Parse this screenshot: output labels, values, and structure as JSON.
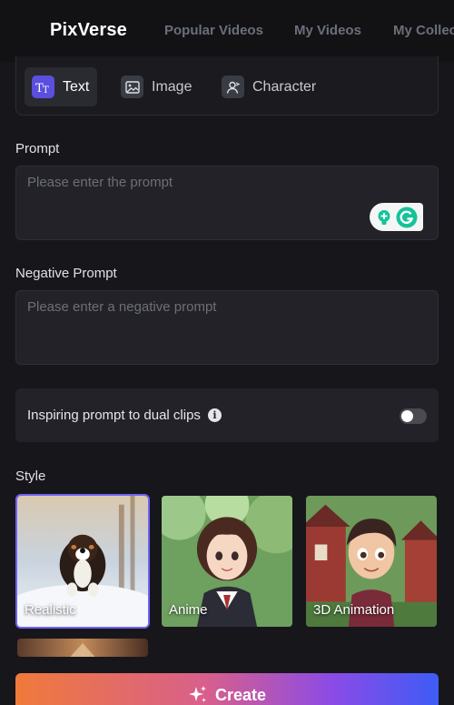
{
  "header": {
    "logo": "PixVerse",
    "nav": [
      "Popular Videos",
      "My Videos",
      "My Collections"
    ]
  },
  "modes": [
    {
      "label": "Text",
      "icon": "text-icon",
      "active": true
    },
    {
      "label": "Image",
      "icon": "image-icon",
      "active": false
    },
    {
      "label": "Character",
      "icon": "character-icon",
      "active": false
    }
  ],
  "prompt": {
    "label": "Prompt",
    "placeholder": "Please enter the prompt",
    "value": ""
  },
  "negative_prompt": {
    "label": "Negative Prompt",
    "placeholder": "Please enter a negative prompt",
    "value": ""
  },
  "dual_clips": {
    "label": "Inspiring prompt to dual clips",
    "enabled": false
  },
  "style": {
    "label": "Style",
    "options": [
      {
        "name": "Realistic",
        "selected": true
      },
      {
        "name": "Anime",
        "selected": false
      },
      {
        "name": "3D Animation",
        "selected": false
      }
    ]
  },
  "create": {
    "label": "Create"
  },
  "colors": {
    "accent": "#6f62f2",
    "background": "#17171b",
    "panel": "#222228"
  }
}
